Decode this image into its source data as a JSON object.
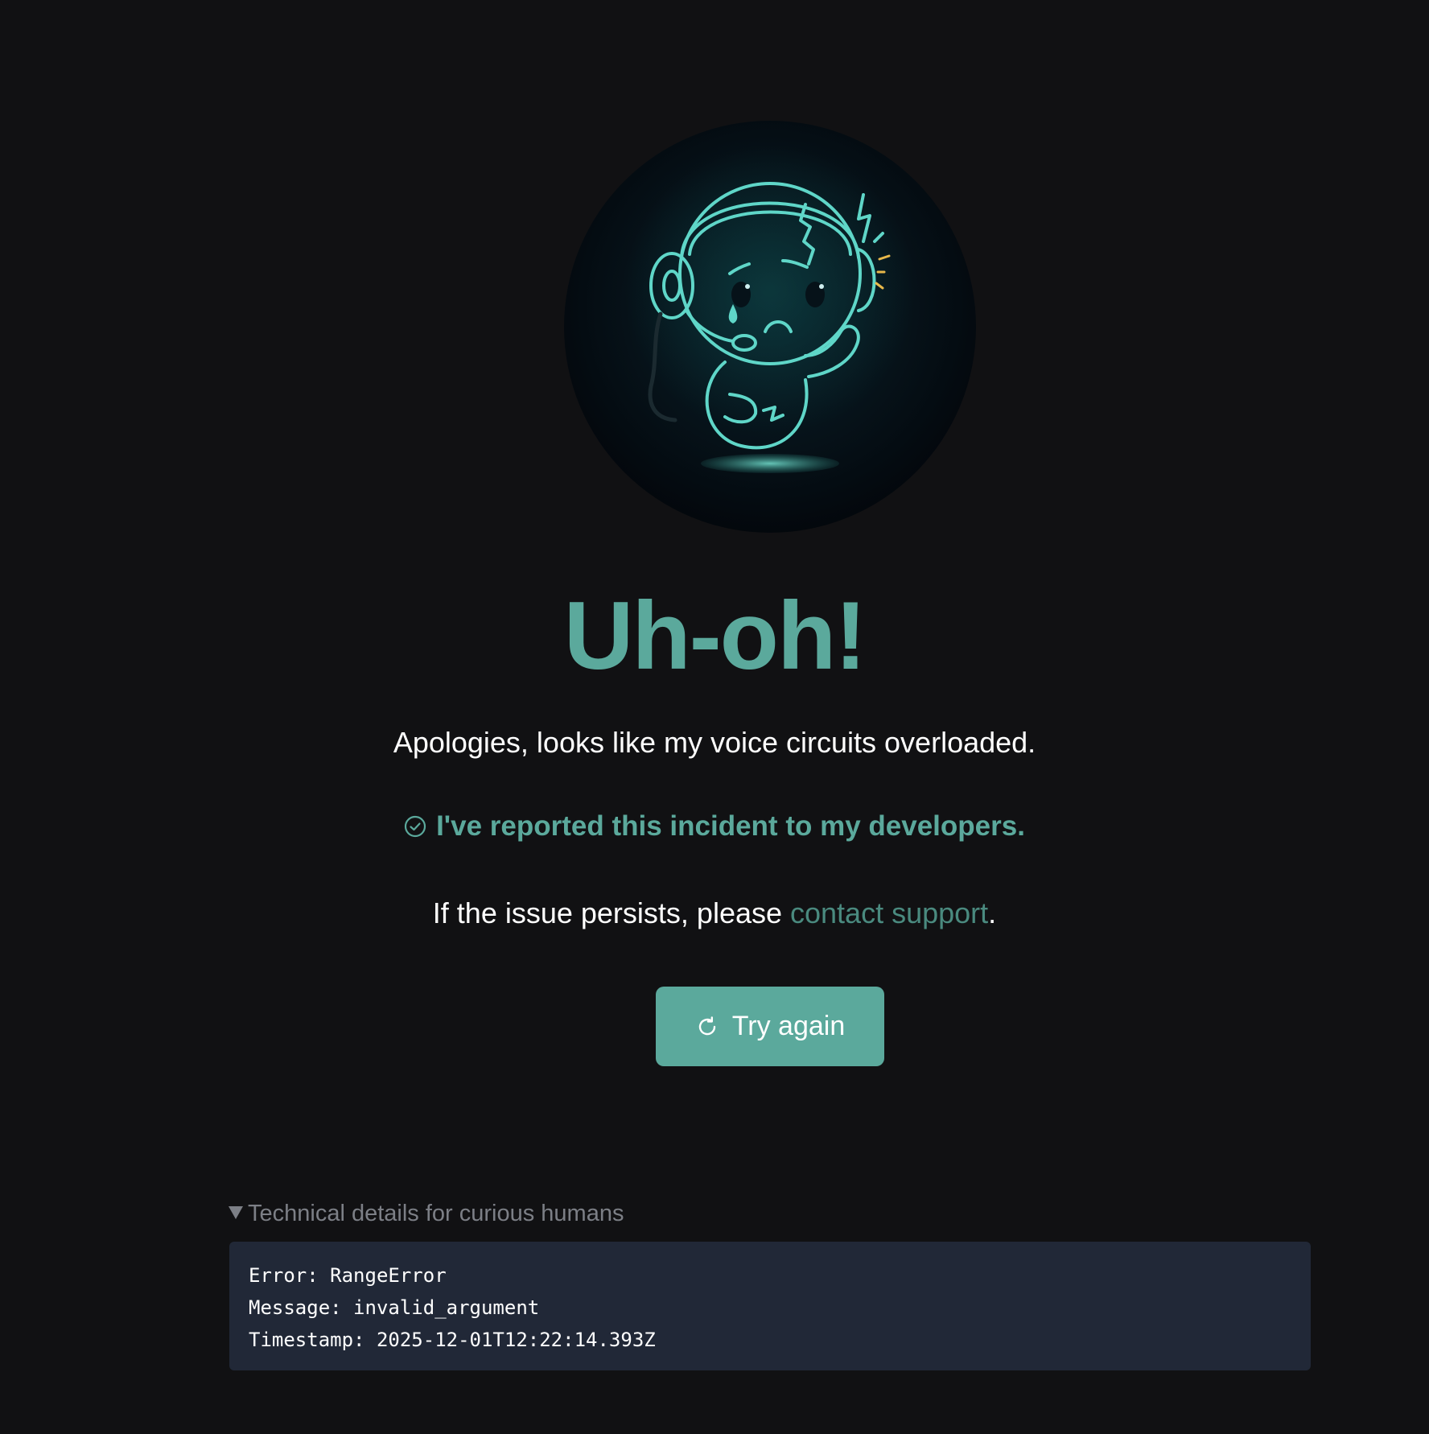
{
  "heading": "Uh-oh!",
  "apology": "Apologies, looks like my voice circuits overloaded.",
  "reported": "I've reported this incident to my developers.",
  "persist": {
    "prefix": "If the issue persists, please ",
    "link": "contact support",
    "suffix": "."
  },
  "retry_button": {
    "label": "Try again",
    "icon": "refresh-icon"
  },
  "details": {
    "summary": "Technical details for curious humans",
    "lines": [
      "Error: RangeError",
      "Message: invalid_argument",
      "Timestamp: 2025-12-01T12:22:14.393Z"
    ]
  },
  "colors": {
    "accent": "#5ba99c",
    "link": "#4a8a7f",
    "background": "#111113",
    "details_bg": "#212837"
  },
  "illustration": {
    "icon": "sad-headset-robot-icon"
  }
}
